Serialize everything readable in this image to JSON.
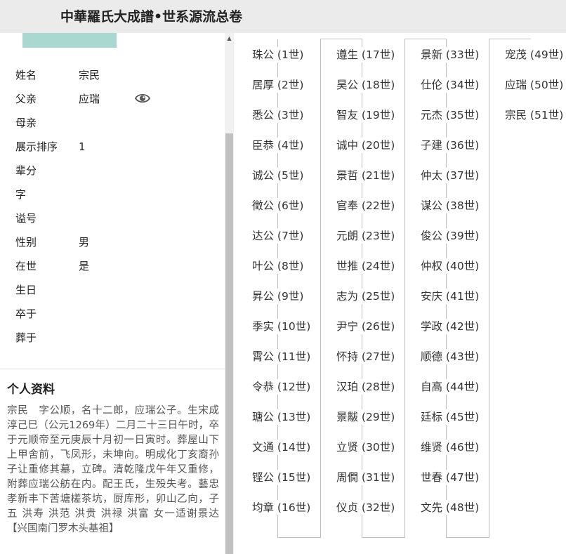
{
  "header": {
    "title": "中華羅氏大成譜•世系源流总卷"
  },
  "person": {
    "fields": [
      {
        "label": "姓名",
        "value": "宗民"
      },
      {
        "label": "父亲",
        "value": "应瑞"
      },
      {
        "label": "母亲",
        "value": ""
      },
      {
        "label": "展示排序",
        "value": "1"
      },
      {
        "label": "辈分",
        "value": ""
      },
      {
        "label": "字",
        "value": ""
      },
      {
        "label": "谥号",
        "value": ""
      },
      {
        "label": "性别",
        "value": "男"
      },
      {
        "label": "在世",
        "value": "是"
      },
      {
        "label": "生日",
        "value": ""
      },
      {
        "label": "卒于",
        "value": ""
      },
      {
        "label": "葬于",
        "value": ""
      }
    ]
  },
  "profile": {
    "title": "个人资料",
    "text": "宗民　字公顺，名十二郎，应瑞公子。生宋成淳己巳（公元1269年）二月二十三日午时，卒于元顺帝至元庚辰十月初一日寅时。葬屋山下上甲舍前，飞凤形，未坤向。明成化丁亥裔孙子让重修其墓，立碑。清乾隆戊午年又重修，附葬应瑞公舫在内。配王氏，生殁失考。藝忠孝新丰下苦塘槎茶坑，厨库形，卯山乙向，子五 洪寿 洪范 洪贵 洪禄 洪富 女一适谢景达【兴国南门罗木头基祖】"
  },
  "icons": {
    "eye": "eye-icon",
    "scroll_up": "scroll-up-arrow-icon"
  },
  "tree": {
    "columns": [
      [
        "珠公 (1世)",
        "居厚 (2世)",
        "悉公 (3世)",
        "臣恭 (4世)",
        "诚公 (5世)",
        "徵公 (6世)",
        "达公 (7世)",
        "叶公 (8世)",
        "昇公 (9世)",
        "季实 (10世)",
        "霄公 (11世)",
        "令恭 (12世)",
        "瑭公 (13世)",
        "文通 (14世)",
        "铿公 (15世)",
        "均章 (16世)"
      ],
      [
        "遵生 (17世)",
        "昊公 (18世)",
        "智友 (19世)",
        "诚中 (20世)",
        "景哲 (21世)",
        "官奉 (22世)",
        "元朗 (23世)",
        "世推 (24世)",
        "志为 (25世)",
        "尹宁 (26世)",
        "怀持 (27世)",
        "汉珀 (28世)",
        "景黻 (29世)",
        "立贤 (30世)",
        "周僩 (31世)",
        "仪贞 (32世)"
      ],
      [
        "景新 (33世)",
        "仕伦 (34世)",
        "元杰 (35世)",
        "子建 (36世)",
        "仲太 (37世)",
        "谋公 (38世)",
        "俊公 (39世)",
        "仲权 (40世)",
        "安庆 (41世)",
        "学政 (42世)",
        "顺德 (43世)",
        "自高 (44世)",
        "廷标 (45世)",
        "维贤 (46世)",
        "世春 (47世)",
        "文先 (48世)"
      ],
      [
        "宠茂 (49世)",
        "应瑞 (50世)",
        "宗民 (51世)"
      ]
    ]
  }
}
